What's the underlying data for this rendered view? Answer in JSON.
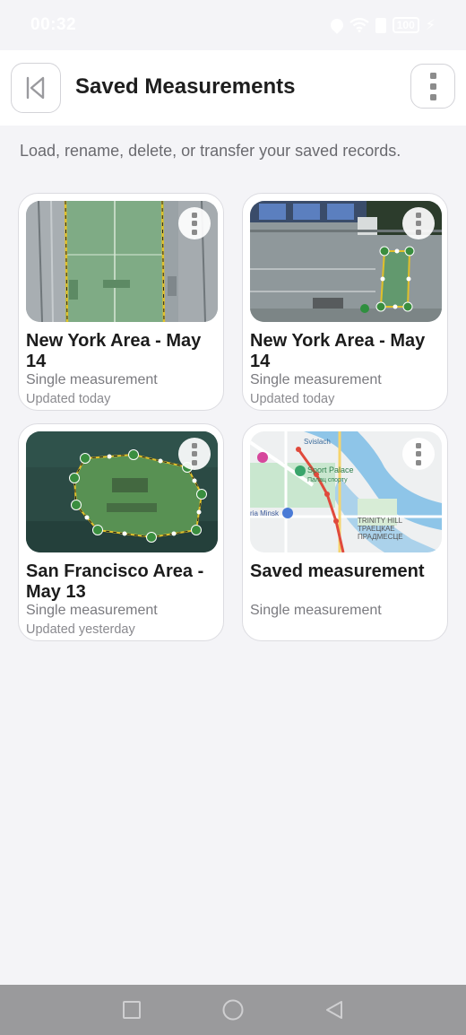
{
  "status_bar": {
    "time": "00:32",
    "battery": "100"
  },
  "header": {
    "title": "Saved Measurements",
    "back_icon": "skip-back-icon",
    "menu_icon": "more-vertical-icon"
  },
  "subtitle": "Load, rename, delete, or transfer your saved records.",
  "cards": [
    {
      "title": "New York Area - May 14",
      "subtitle": "Single measurement",
      "updated": "Updated today",
      "thumbnail": "satellite-tennis-court"
    },
    {
      "title": "New York Area - May 14",
      "subtitle": "Single measurement",
      "updated": "Updated today",
      "thumbnail": "satellite-parking-lot"
    },
    {
      "title": "San Francisco Area - May 13",
      "subtitle": "Single measurement",
      "updated": "Updated yesterday",
      "thumbnail": "satellite-island"
    },
    {
      "title": "Saved measurement",
      "subtitle": "Single measurement",
      "updated": "",
      "thumbnail": "street-map-minsk"
    }
  ],
  "map_labels": {
    "sport_palace": "Sport Palace",
    "sport_palace_local": "Палац спорту",
    "trinity_hill": "TRINITY HILL",
    "trinity_hill_local": "ТРАЕЦКАЕ",
    "trinity_hill_local2": "ПРАДМЕСЦЕ",
    "ria_minsk": "ria Minsk",
    "svislach": "Svislach"
  },
  "colors": {
    "accent_green": "#2e8b3a",
    "background": "#f4f4f7",
    "navbar": "#9a9a9c"
  }
}
